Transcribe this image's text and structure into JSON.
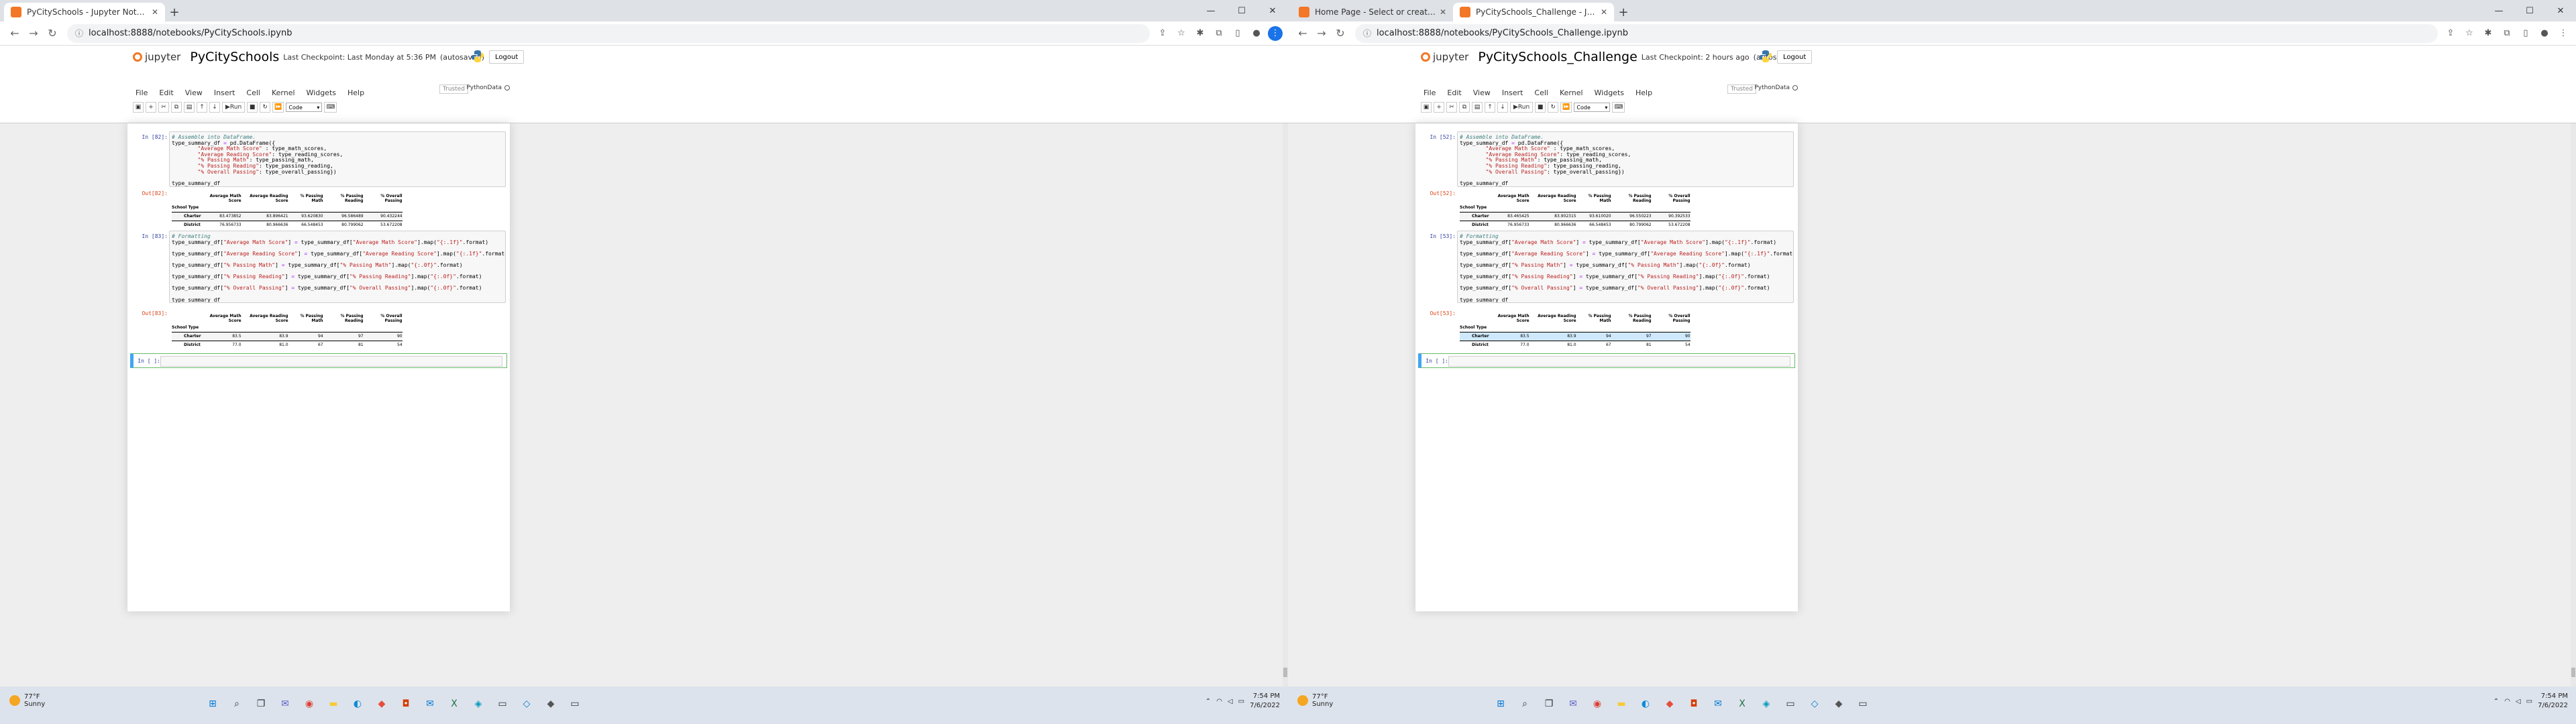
{
  "windows": [
    {
      "side": "left",
      "tabs": [
        {
          "title": "PyCitySchools - Jupyter Notebook",
          "active": true,
          "fav_color": "#f37726"
        }
      ],
      "url": "localhost:8888/notebooks/PyCitySchools.ipynb",
      "notebook": {
        "logo": "jupyter",
        "name": "PyCitySchools",
        "checkpoint": "Last Checkpoint: Last Monday at 5:36 PM",
        "autosaved": "(autosaved)",
        "logout": "Logout",
        "trusted": "Trusted",
        "kernel": "PythonData",
        "menus": [
          "File",
          "Edit",
          "View",
          "Insert",
          "Cell",
          "Kernel",
          "Widgets",
          "Help"
        ],
        "toolbar_run": "Run",
        "cell_type": "Code",
        "cells": {
          "in1_prompt": "In [82]:",
          "out1_prompt": "Out[82]:",
          "in2_prompt": "In [83]:",
          "out2_prompt": "Out[83]:",
          "empty_prompt": "In [ ]:",
          "table1": {
            "columns": [
              "Average Math Score",
              "Average Reading Score",
              "% Passing Math",
              "% Passing Reading",
              "% Overall Passing"
            ],
            "index_name": "School Type",
            "rows": [
              {
                "name": "Charter",
                "values": [
                  "83.473852",
                  "83.896421",
                  "93.620830",
                  "96.586489",
                  "90.432244"
                ]
              },
              {
                "name": "District",
                "values": [
                  "76.956733",
                  "80.966636",
                  "66.548453",
                  "80.799062",
                  "53.672208"
                ]
              }
            ]
          },
          "table2": {
            "columns": [
              "Average Math Score",
              "Average Reading Score",
              "% Passing Math",
              "% Passing Reading",
              "% Overall Passing"
            ],
            "index_name": "School Type",
            "rows": [
              {
                "name": "Charter",
                "values": [
                  "83.5",
                  "83.9",
                  "94",
                  "97",
                  "90"
                ]
              },
              {
                "name": "District",
                "values": [
                  "77.0",
                  "81.0",
                  "67",
                  "81",
                  "54"
                ]
              }
            ]
          }
        }
      }
    },
    {
      "side": "right",
      "tabs": [
        {
          "title": "Home Page - Select or create a n",
          "active": false,
          "fav_color": "#f37726"
        },
        {
          "title": "PyCitySchools_Challenge - Jupyt",
          "active": true,
          "fav_color": "#f37726"
        }
      ],
      "url": "localhost:8888/notebooks/PyCitySchools_Challenge.ipynb",
      "notebook": {
        "logo": "jupyter",
        "name": "PyCitySchools_Challenge",
        "checkpoint": "Last Checkpoint: 2 hours ago",
        "autosaved": "(autosaved)",
        "logout": "Logout",
        "trusted": "Trusted",
        "kernel": "PythonData",
        "menus": [
          "File",
          "Edit",
          "View",
          "Insert",
          "Cell",
          "Kernel",
          "Widgets",
          "Help"
        ],
        "toolbar_run": "Run",
        "cell_type": "Code",
        "cells": {
          "in1_prompt": "In [52]:",
          "out1_prompt": "Out[52]:",
          "in2_prompt": "In [53]:",
          "out2_prompt": "Out[53]:",
          "empty_prompt": "In [ ]:",
          "table1": {
            "columns": [
              "Average Math Score",
              "Average Reading Score",
              "% Passing Math",
              "% Passing Reading",
              "% Overall Passing"
            ],
            "index_name": "School Type",
            "rows": [
              {
                "name": "Charter",
                "values": [
                  "83.465425",
                  "83.902315",
                  "93.610020",
                  "96.550223",
                  "90.392533"
                ]
              },
              {
                "name": "District",
                "values": [
                  "76.956733",
                  "80.966636",
                  "66.548453",
                  "80.799062",
                  "53.672208"
                ]
              }
            ]
          },
          "table2": {
            "columns": [
              "Average Math Score",
              "Average Reading Score",
              "% Passing Math",
              "% Passing Reading",
              "% Overall Passing"
            ],
            "index_name": "School Type",
            "rows": [
              {
                "name": "Charter",
                "values": [
                  "83.5",
                  "83.9",
                  "94",
                  "97",
                  "90"
                ]
              },
              {
                "name": "District",
                "values": [
                  "77.0",
                  "81.0",
                  "67",
                  "81",
                  "54"
                ]
              }
            ]
          }
        }
      }
    }
  ],
  "code": {
    "cell1": [
      "# Assemble into DataFrame.",
      "type_summary_df = pd.DataFrame({",
      "        \"Average Math Score\" : type_math_scores,",
      "        \"Average Reading Score\": type_reading_scores,",
      "        \"% Passing Math\": type_passing_math,",
      "        \"% Passing Reading\": type_passing_reading,",
      "        \"% Overall Passing\": type_overall_passing})",
      "",
      "type_summary_df"
    ],
    "cell2": [
      "# Formatting",
      "type_summary_df[\"Average Math Score\"] = type_summary_df[\"Average Math Score\"].map(\"{:.1f}\".format)",
      "",
      "type_summary_df[\"Average Reading Score\"] = type_summary_df[\"Average Reading Score\"].map(\"{:.1f}\".format)",
      "",
      "type_summary_df[\"% Passing Math\"] = type_summary_df[\"% Passing Math\"].map(\"{:.0f}\".format)",
      "",
      "type_summary_df[\"% Passing Reading\"] = type_summary_df[\"% Passing Reading\"].map(\"{:.0f}\".format)",
      "",
      "type_summary_df[\"% Overall Passing\"] = type_summary_df[\"% Overall Passing\"].map(\"{:.0f}\".format)",
      "",
      "type_summary_df"
    ]
  },
  "taskbar": {
    "left": {
      "temp": "77°F",
      "condition": "Sunny",
      "time": "7:54 PM",
      "date": "7/6/2022"
    },
    "right": {
      "temp": "77°F",
      "condition": "Sunny",
      "time": "7:54 PM",
      "date": "7/6/2022"
    },
    "apps": [
      {
        "name": "start",
        "color": "#0078d4"
      },
      {
        "name": "search",
        "color": "#333333"
      },
      {
        "name": "task-view",
        "color": "#333333"
      },
      {
        "name": "chat",
        "color": "#5b5fc7"
      },
      {
        "name": "chrome",
        "color": "#db4437"
      },
      {
        "name": "file-explorer",
        "color": "#f8c93b"
      },
      {
        "name": "edge",
        "color": "#0c8ad6"
      },
      {
        "name": "app-red",
        "color": "#e74c3c"
      },
      {
        "name": "office",
        "color": "#d83b01"
      },
      {
        "name": "mail",
        "color": "#0078d4"
      },
      {
        "name": "excel",
        "color": "#217346"
      },
      {
        "name": "photos",
        "color": "#0099bc"
      },
      {
        "name": "terminal",
        "color": "#2d2d2d"
      },
      {
        "name": "vscode",
        "color": "#007acc"
      },
      {
        "name": "git",
        "color": "#555555"
      },
      {
        "name": "monitor",
        "color": "#333333"
      }
    ]
  }
}
